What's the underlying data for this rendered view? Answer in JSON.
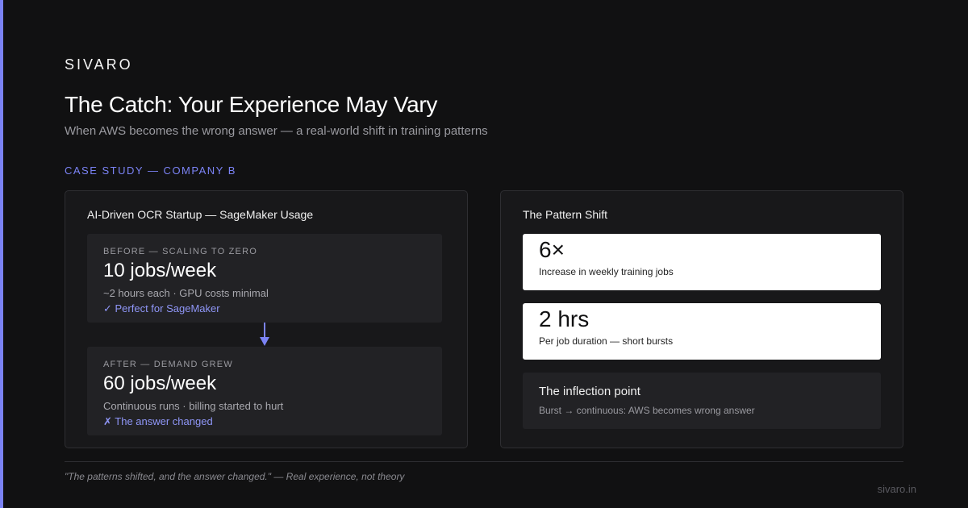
{
  "brand": "SIVARO",
  "title": "The Catch: Your Experience May Vary",
  "subtitle": "When AWS becomes the wrong answer — a real-world shift in training patterns",
  "section_label": "CASE STUDY — COMPANY B",
  "left_card": {
    "title": "AI-Driven OCR Startup — SageMaker Usage",
    "before": {
      "label": "BEFORE — SCALING TO ZERO",
      "value": "10 jobs/week",
      "detail": "~2 hours each · GPU costs minimal",
      "note": "✓ Perfect for SageMaker"
    },
    "after": {
      "label": "AFTER — DEMAND GREW",
      "value": "60 jobs/week",
      "detail": "Continuous runs · billing started to hurt",
      "note": "✗ The answer changed"
    }
  },
  "right_card": {
    "title": "The Pattern Shift",
    "stats": [
      {
        "value": "6×",
        "label": "Increase in weekly training jobs"
      },
      {
        "value": "2 hrs",
        "label": "Per job duration — short bursts"
      }
    ],
    "inflection": {
      "title": "The inflection point",
      "text": "Burst → continuous: AWS becomes wrong answer"
    }
  },
  "footer": {
    "quote": "\"The patterns shifted, and the answer changed.\" — Real experience, not theory",
    "domain": "sivaro.in"
  },
  "colors": {
    "accent": "#7b83f5",
    "background": "#111112",
    "card": "#18181a"
  }
}
